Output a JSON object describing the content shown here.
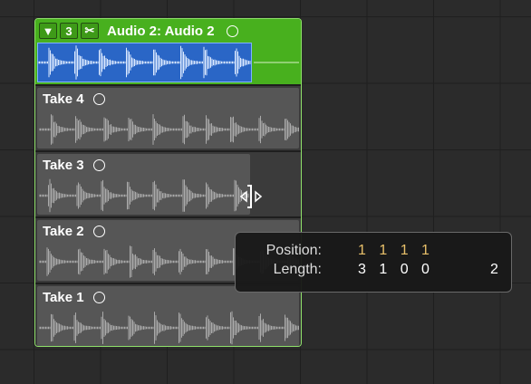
{
  "folder": {
    "disclosure_icon": "triangle-down-icon",
    "take_count": "3",
    "quick_swipe_icon": "scissors-icon",
    "title": "Audio 2: Audio 2"
  },
  "takes": [
    {
      "label": "Take 4"
    },
    {
      "label": "Take 3"
    },
    {
      "label": "Take 2"
    },
    {
      "label": "Take 1"
    }
  ],
  "hud": {
    "position_label": "Position:",
    "position_value": "1 1 1 1",
    "length_label": "Length:",
    "length_value": "3 1 0 0",
    "length_extra": "2"
  },
  "colors": {
    "folder_green": "#48b01e",
    "comp_blue": "#2a66c6",
    "position_value": "#e8c06a"
  }
}
